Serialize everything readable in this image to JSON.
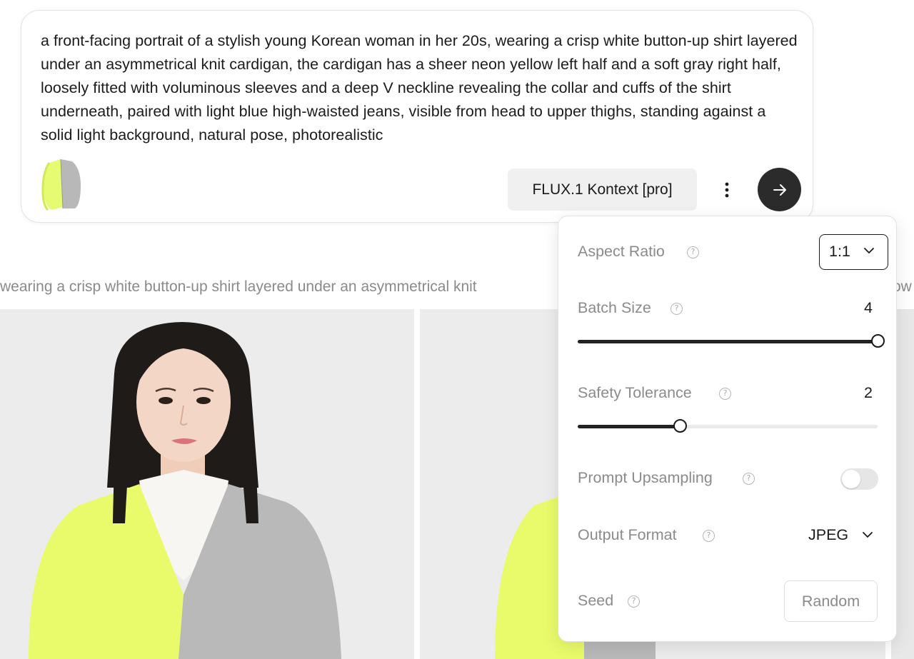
{
  "prompt": {
    "text": "a front-facing portrait of a stylish young Korean woman in her 20s, wearing a crisp white button-up shirt layered under an asymmetrical knit cardigan, the cardigan has a sheer neon yellow left half and a soft gray right half, loosely fitted with voluminous sleeves and a deep V neckline revealing the collar and cuffs of the shirt underneath, paired with light blue high-waisted jeans, visible from head to upper thighs, standing against a solid light background, natural pose, photorealistic",
    "model_label": "FLUX.1 Kontext [pro]",
    "send_icon": "arrow-right-icon",
    "more_icon": "kebab-icon"
  },
  "caption": {
    "text": "wearing a crisp white button-up shirt layered under an asymmetrical knit",
    "tail": "ow"
  },
  "settings": {
    "aspect_ratio": {
      "label": "Aspect Ratio",
      "value": "1:1"
    },
    "batch_size": {
      "label": "Batch Size",
      "value": "4",
      "level": 1.0
    },
    "safety_tolerance": {
      "label": "Safety Tolerance",
      "value": "2",
      "level": 0.34
    },
    "prompt_upsampling": {
      "label": "Prompt Upsampling",
      "enabled": false
    },
    "output_format": {
      "label": "Output Format",
      "value": "JPEG"
    },
    "seed": {
      "label": "Seed",
      "placeholder": "Random"
    }
  },
  "colors": {
    "cardigan_yellow": "#e9fb6a",
    "cardigan_gray": "#b9b9b9",
    "send_button": "#2b2b2b"
  }
}
